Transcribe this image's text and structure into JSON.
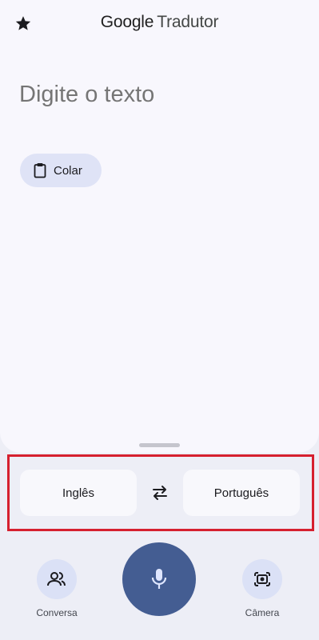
{
  "app": {
    "brand": "Google",
    "product": "Tradutor"
  },
  "input": {
    "placeholder": "Digite o texto",
    "value": ""
  },
  "paste": {
    "label": "Colar",
    "icon": "clipboard-icon"
  },
  "languages": {
    "source": "Inglês",
    "target": "Português",
    "swap_icon": "swap-arrows-icon"
  },
  "bottom": {
    "conversation_label": "Conversa",
    "camera_label": "Câmera",
    "mic_icon": "microphone-icon"
  },
  "colors": {
    "accent": "#445d92",
    "chip": "#dfe3f6",
    "highlight": "#d6202f"
  }
}
